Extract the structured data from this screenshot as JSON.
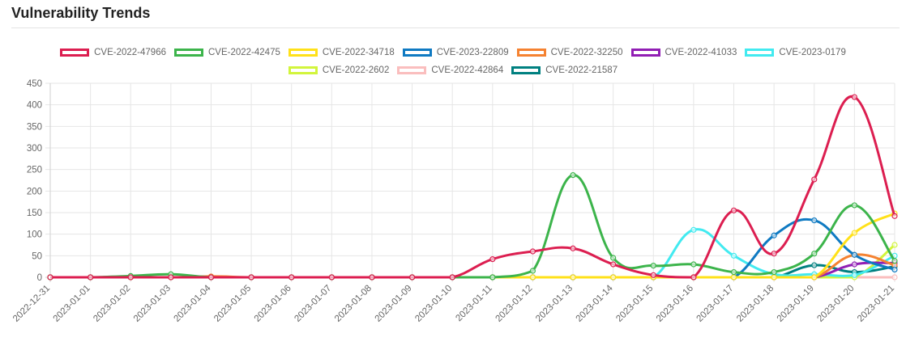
{
  "page": {
    "title": "Vulnerability Trends"
  },
  "chart_data": {
    "type": "line",
    "title": "",
    "xlabel": "",
    "ylabel": "",
    "ylim": [
      0,
      450
    ],
    "yticks": [
      0,
      50,
      100,
      150,
      200,
      250,
      300,
      350,
      400,
      450
    ],
    "grid": true,
    "legend_position": "top",
    "categories": [
      "2022-12-31",
      "2023-01-01",
      "2023-01-02",
      "2023-01-03",
      "2023-01-04",
      "2023-01-05",
      "2023-01-06",
      "2023-01-07",
      "2023-01-08",
      "2023-01-09",
      "2023-01-10",
      "2023-01-11",
      "2023-01-12",
      "2023-01-13",
      "2023-01-14",
      "2023-01-15",
      "2023-01-16",
      "2023-01-17",
      "2023-01-18",
      "2023-01-19",
      "2023-01-20",
      "2023-01-21"
    ],
    "series": [
      {
        "name": "CVE-2022-47966",
        "color": "#dc1e50",
        "values": [
          0,
          0,
          0,
          0,
          0,
          0,
          0,
          0,
          0,
          0,
          0,
          42,
          60,
          67,
          30,
          5,
          0,
          155,
          55,
          227,
          418,
          142
        ]
      },
      {
        "name": "CVE-2022-42475",
        "color": "#3cb44b",
        "values": [
          0,
          0,
          3,
          7,
          0,
          0,
          0,
          0,
          0,
          0,
          0,
          0,
          15,
          237,
          45,
          27,
          30,
          12,
          12,
          55,
          167,
          38
        ]
      },
      {
        "name": "CVE-2022-34718",
        "color": "#ffe119",
        "values": [
          0,
          0,
          0,
          0,
          0,
          0,
          0,
          0,
          0,
          0,
          0,
          0,
          0,
          0,
          0,
          0,
          0,
          0,
          0,
          0,
          103,
          148
        ]
      },
      {
        "name": "CVE-2023-22809",
        "color": "#0f7ac2",
        "values": [
          0,
          0,
          0,
          0,
          0,
          0,
          0,
          0,
          0,
          0,
          0,
          0,
          0,
          0,
          0,
          0,
          0,
          0,
          97,
          132,
          52,
          18
        ]
      },
      {
        "name": "CVE-2022-32250",
        "color": "#f58231",
        "values": [
          0,
          0,
          0,
          0,
          2,
          0,
          0,
          0,
          0,
          0,
          0,
          0,
          0,
          0,
          0,
          0,
          0,
          0,
          0,
          0,
          52,
          28
        ]
      },
      {
        "name": "CVE-2022-41033",
        "color": "#911eb4",
        "values": [
          0,
          0,
          0,
          0,
          0,
          0,
          0,
          0,
          0,
          0,
          0,
          0,
          0,
          0,
          0,
          0,
          0,
          0,
          0,
          0,
          30,
          33
        ]
      },
      {
        "name": "CVE-2023-0179",
        "color": "#42eaf0",
        "values": [
          0,
          0,
          0,
          0,
          0,
          0,
          0,
          0,
          0,
          0,
          0,
          0,
          0,
          0,
          0,
          0,
          110,
          50,
          7,
          7,
          5,
          50
        ]
      },
      {
        "name": "CVE-2022-2602",
        "color": "#d2f53c",
        "values": [
          0,
          0,
          0,
          0,
          0,
          0,
          0,
          0,
          0,
          0,
          0,
          0,
          0,
          0,
          0,
          0,
          0,
          0,
          0,
          0,
          0,
          75
        ]
      },
      {
        "name": "CVE-2022-42864",
        "color": "#fabebe",
        "values": [
          0,
          0,
          0,
          0,
          0,
          0,
          0,
          0,
          0,
          0,
          0,
          0,
          0,
          0,
          0,
          0,
          0,
          0,
          0,
          0,
          0,
          0
        ]
      },
      {
        "name": "CVE-2022-21587",
        "color": "#008080",
        "values": [
          0,
          0,
          0,
          0,
          0,
          0,
          0,
          0,
          0,
          0,
          0,
          0,
          0,
          0,
          0,
          0,
          0,
          0,
          0,
          28,
          12,
          25
        ]
      }
    ]
  }
}
